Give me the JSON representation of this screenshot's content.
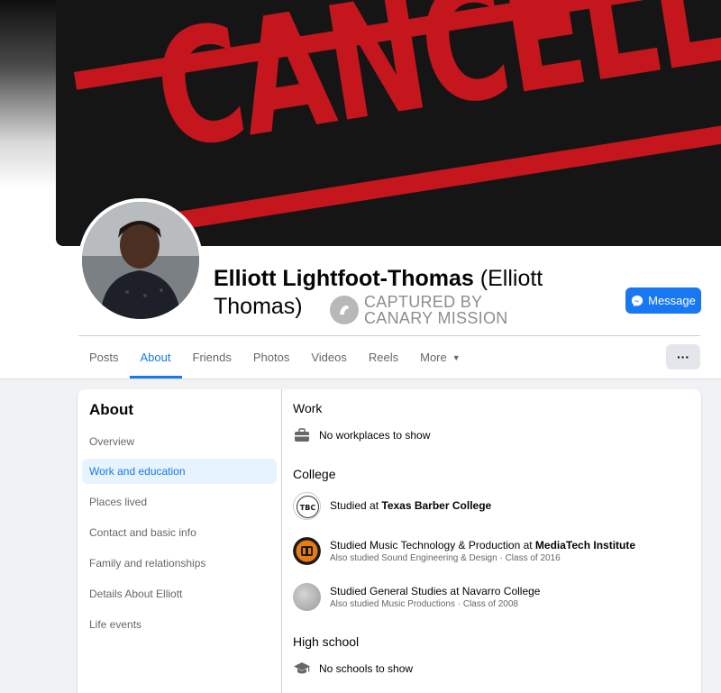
{
  "cover": {
    "banner_text": "CANCELLED"
  },
  "profile": {
    "name": "Elliott Lightfoot-Thomas",
    "alt_name_part1": "(Elliott",
    "alt_name_part2": "Thomas)",
    "captured_line1": "CAPTURED BY",
    "captured_line2": "CANARY MISSION",
    "message_label": "Message",
    "more_actions_label": "···"
  },
  "tabs": [
    {
      "label": "Posts",
      "active": false
    },
    {
      "label": "About",
      "active": true
    },
    {
      "label": "Friends",
      "active": false
    },
    {
      "label": "Photos",
      "active": false
    },
    {
      "label": "Videos",
      "active": false
    },
    {
      "label": "Reels",
      "active": false
    },
    {
      "label": "More",
      "active": false
    }
  ],
  "about": {
    "title": "About",
    "nav": [
      {
        "label": "Overview",
        "active": false
      },
      {
        "label": "Work and education",
        "active": true
      },
      {
        "label": "Places lived",
        "active": false
      },
      {
        "label": "Contact and basic info",
        "active": false
      },
      {
        "label": "Family and relationships",
        "active": false
      },
      {
        "label": "Details About Elliott",
        "active": false
      },
      {
        "label": "Life events",
        "active": false
      }
    ],
    "work": {
      "title": "Work",
      "empty": "No workplaces to show",
      "icon": "briefcase-icon"
    },
    "college": {
      "title": "College",
      "entries": [
        {
          "prefix": "Studied at ",
          "school": "Texas Barber College",
          "sub": "",
          "logo": "tbc-logo"
        },
        {
          "prefix": "Studied Music Technology & Production at ",
          "school": "MediaTech Institute",
          "sub": "Also studied Sound Engineering & Design · Class of 2016",
          "logo": "mediatech-logo"
        },
        {
          "prefix": "Studied General Studies at Navarro College",
          "school": "",
          "sub": "Also studied Music Productions · Class of 2008",
          "logo": "navarro-logo"
        }
      ],
      "tbc_logo_text": "TBC"
    },
    "high_school": {
      "title": "High school",
      "empty": "No schools to show",
      "icon": "graduation-cap-icon"
    }
  },
  "colors": {
    "accent": "#1877f2",
    "cover_red": "#c4161c",
    "active_bg": "#e7f3ff"
  }
}
